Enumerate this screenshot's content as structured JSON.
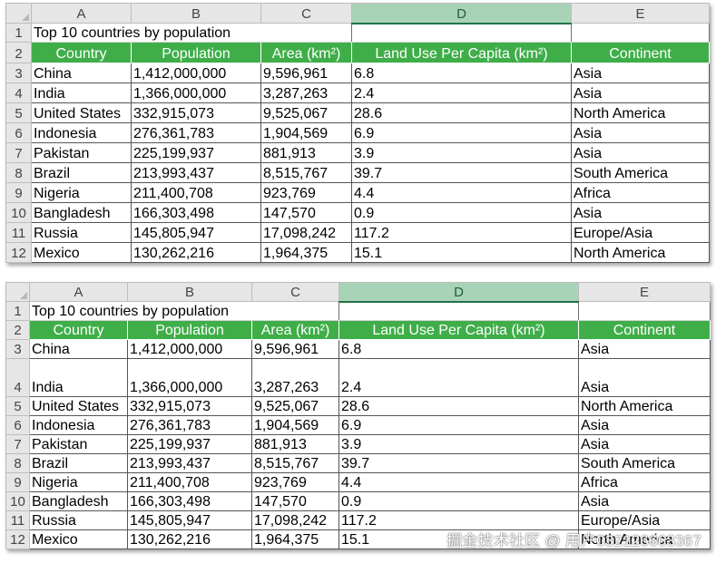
{
  "sheet1": {
    "columns": [
      "A",
      "B",
      "C",
      "D",
      "E"
    ],
    "selected_column": "D",
    "title": "Top 10 countries by population",
    "headers": [
      "Country",
      "Population",
      "Area (km²)",
      "Land Use Per Capita (km²)",
      "Continent"
    ],
    "row_numbers": [
      "1",
      "2",
      "3",
      "4",
      "5",
      "6",
      "7",
      "8",
      "9",
      "10",
      "11",
      "12"
    ],
    "rows": [
      [
        "China",
        "1,412,000,000",
        "9,596,961",
        "6.8",
        "Asia"
      ],
      [
        "India",
        "1,366,000,000",
        "3,287,263",
        "2.4",
        "Asia"
      ],
      [
        "United States",
        "332,915,073",
        "9,525,067",
        "28.6",
        "North America"
      ],
      [
        "Indonesia",
        "276,361,783",
        "1,904,569",
        "6.9",
        "Asia"
      ],
      [
        "Pakistan",
        "225,199,937",
        "881,913",
        "3.9",
        "Asia"
      ],
      [
        "Brazil",
        "213,993,437",
        "8,515,767",
        "39.7",
        "South America"
      ],
      [
        "Nigeria",
        "211,400,708",
        "923,769",
        "4.4",
        "Africa"
      ],
      [
        "Bangladesh",
        "166,303,498",
        "147,570",
        "0.9",
        "Asia"
      ],
      [
        "Russia",
        "145,805,947",
        "17,098,242",
        "117.2",
        "Europe/Asia"
      ],
      [
        "Mexico",
        "130,262,216",
        "1,964,375",
        "15.1",
        "North America"
      ]
    ]
  },
  "sheet2": {
    "columns": [
      "A",
      "B",
      "C",
      "D",
      "E"
    ],
    "selected_column": "D",
    "title": "Top 10 countries by population",
    "headers": [
      "Country",
      "Population",
      "Area (km²)",
      "Land Use Per Capita (km²)",
      "Continent"
    ],
    "row_numbers": [
      "1",
      "2",
      "3",
      "4",
      "5",
      "6",
      "7",
      "8",
      "9",
      "10",
      "11",
      "12"
    ],
    "rows": [
      [
        "China",
        "1,412,000,000",
        "9,596,961",
        "6.8",
        "Asia"
      ],
      [
        "India",
        "1,366,000,000",
        "3,287,263",
        "2.4",
        "Asia"
      ],
      [
        "United States",
        "332,915,073",
        "9,525,067",
        "28.6",
        "North America"
      ],
      [
        "Indonesia",
        "276,361,783",
        "1,904,569",
        "6.9",
        "Asia"
      ],
      [
        "Pakistan",
        "225,199,937",
        "881,913",
        "3.9",
        "Asia"
      ],
      [
        "Brazil",
        "213,993,437",
        "8,515,767",
        "39.7",
        "South America"
      ],
      [
        "Nigeria",
        "211,400,708",
        "923,769",
        "4.4",
        "Africa"
      ],
      [
        "Bangladesh",
        "166,303,498",
        "147,570",
        "0.9",
        "Asia"
      ],
      [
        "Russia",
        "145,805,947",
        "17,098,242",
        "117.2",
        "Europe/Asia"
      ],
      [
        "Mexico",
        "130,262,216",
        "1,964,375",
        "15.1",
        "North America"
      ]
    ]
  },
  "watermark": "掘金技术社区 @ 用户032126663367",
  "colors": {
    "header_green": "#3fae49",
    "selected_column_header": "#a9d3b6",
    "sheet_header_gray": "#e6e6e6"
  }
}
